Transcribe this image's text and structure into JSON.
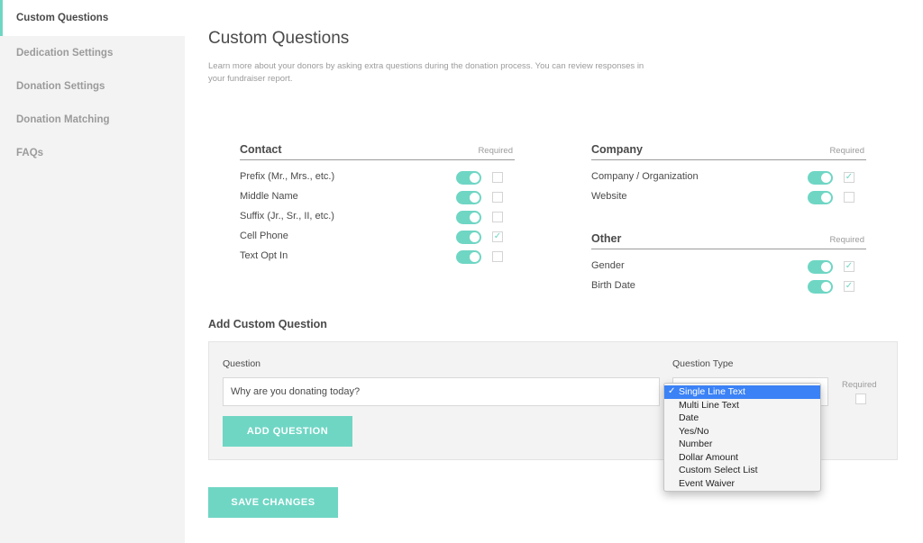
{
  "sidebar": {
    "items": [
      {
        "label": "Custom Questions"
      },
      {
        "label": "Dedication Settings"
      },
      {
        "label": "Donation Settings"
      },
      {
        "label": "Donation Matching"
      },
      {
        "label": "FAQs"
      }
    ]
  },
  "page": {
    "title": "Custom Questions",
    "description": "Learn more about your donors by asking extra questions during the donation process. You can review responses in your fundraiser report."
  },
  "groups": {
    "contact": {
      "title": "Contact",
      "required_label": "Required",
      "fields": [
        {
          "label": "Prefix (Mr., Mrs., etc.)",
          "enabled": true,
          "required": false
        },
        {
          "label": "Middle Name",
          "enabled": true,
          "required": false
        },
        {
          "label": "Suffix (Jr., Sr., II, etc.)",
          "enabled": true,
          "required": false
        },
        {
          "label": "Cell Phone",
          "enabled": true,
          "required": true
        },
        {
          "label": "Text Opt In",
          "enabled": true,
          "required": false
        }
      ]
    },
    "company": {
      "title": "Company",
      "required_label": "Required",
      "fields": [
        {
          "label": "Company / Organization",
          "enabled": true,
          "required": true
        },
        {
          "label": "Website",
          "enabled": true,
          "required": false
        }
      ]
    },
    "other": {
      "title": "Other",
      "required_label": "Required",
      "fields": [
        {
          "label": "Gender",
          "enabled": true,
          "required": true
        },
        {
          "label": "Birth Date",
          "enabled": true,
          "required": true
        }
      ]
    }
  },
  "add_question": {
    "title": "Add Custom Question",
    "question_label": "Question",
    "question_value": "Why are you donating today?",
    "type_label": "Question Type",
    "required_label": "Required",
    "add_button": "ADD QUESTION",
    "type_options": [
      {
        "label": "Single Line Text",
        "selected": true
      },
      {
        "label": "Multi Line Text",
        "selected": false
      },
      {
        "label": "Date",
        "selected": false
      },
      {
        "label": "Yes/No",
        "selected": false
      },
      {
        "label": "Number",
        "selected": false
      },
      {
        "label": "Dollar Amount",
        "selected": false
      },
      {
        "label": "Custom Select List",
        "selected": false
      },
      {
        "label": "Event Waiver",
        "selected": false
      }
    ],
    "selected_check": "✓"
  },
  "save_button": "SAVE CHANGES",
  "colors": {
    "accent": "#6fd6c4",
    "highlight": "#3b82f6"
  },
  "icons": {
    "check": "checkmark-icon"
  }
}
